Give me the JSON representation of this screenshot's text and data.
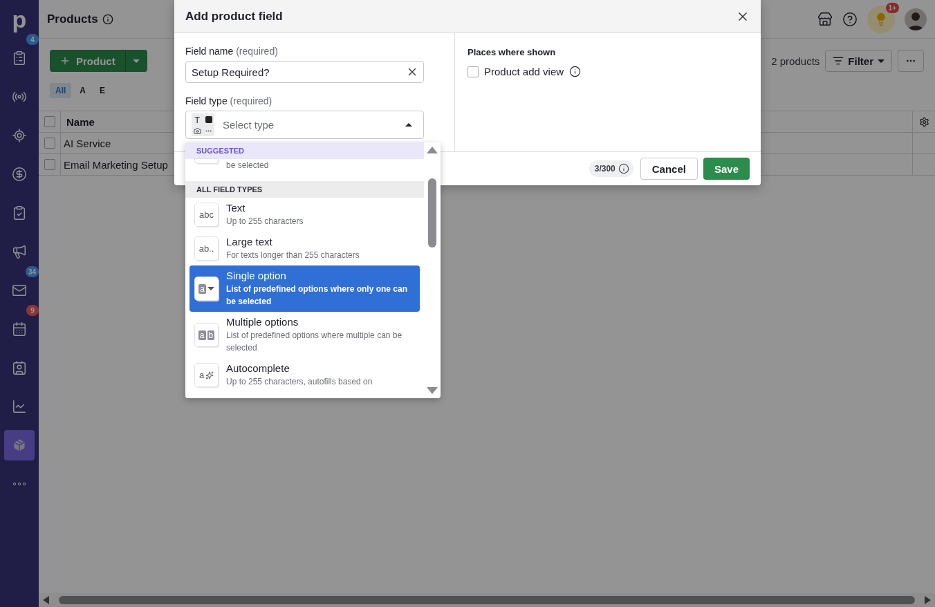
{
  "sidebar": {
    "logo": "p",
    "items": [
      {
        "selected": false,
        "badge": {
          "text": "4",
          "color": "#2b5a8f"
        }
      },
      {
        "selected": false
      },
      {
        "selected": false
      },
      {
        "selected": false
      },
      {
        "selected": false
      },
      {
        "selected": false
      },
      {
        "selected": false,
        "badge": {
          "text": "34",
          "color": "#2b5a8f"
        }
      },
      {
        "selected": false,
        "badge": {
          "text": "9",
          "color": "#8f3535"
        }
      },
      {
        "selected": false
      },
      {
        "selected": false
      },
      {
        "selected": true
      },
      {
        "selected": false
      }
    ]
  },
  "header": {
    "title": "Products",
    "notification_badge": "1+"
  },
  "toolbar": {
    "add_button": "Product",
    "count": "2 products",
    "filter_button": "Filter"
  },
  "letter_filters": [
    {
      "label": "All",
      "selected": true
    },
    {
      "label": "A",
      "selected": false
    },
    {
      "label": "E",
      "selected": false
    }
  ],
  "table": {
    "select_all_checked": false,
    "columns": [
      "Name"
    ],
    "rows": [
      {
        "name": "AI Service",
        "checked": false
      },
      {
        "name": "Email Marketing Setup",
        "checked": false
      }
    ]
  },
  "dialog": {
    "title": "Add product field",
    "field_name": {
      "label": "Field name",
      "hint": "(required)",
      "value": "Setup Required?"
    },
    "field_type": {
      "label": "Field type",
      "hint": "(required)",
      "icon_text": "T",
      "placeholder": "Select type",
      "expanded": true
    },
    "places": {
      "title": "Places where shown",
      "options": [
        {
          "label": "Product add view",
          "checked": false
        }
      ]
    },
    "counter": "3/300",
    "cancel": "Cancel",
    "save": "Save",
    "dropdown": {
      "sections": [
        {
          "title": "SUGGESTED",
          "kind": "suggested",
          "items": [
            {
              "kind": "partial",
              "description": "be selected",
              "selected": false
            }
          ]
        },
        {
          "title": "ALL FIELD TYPES",
          "kind": "all",
          "items": [
            {
              "kind": "plain",
              "icon_text": [
                "abc"
              ],
              "title": "Text",
              "description": "Up to 255 characters",
              "selected": false
            },
            {
              "kind": "plain",
              "icon_text": [
                "ab.."
              ],
              "title": "Large text",
              "description": "For texts longer than 255 characters",
              "selected": false
            },
            {
              "kind": "dropdown",
              "icon_text": [
                "a"
              ],
              "title": "Single option",
              "description": "List of predefined options where only one can be selected",
              "selected": true
            },
            {
              "kind": "chips",
              "icon_text": [
                "a",
                "b"
              ],
              "title": "Multiple options",
              "description": "List of predefined options where multiple can be selected",
              "selected": false
            },
            {
              "kind": "sparkle",
              "icon_text": [
                "a"
              ],
              "title": "Autocomplete",
              "description": "Up to 255 characters, autofills based on",
              "selected": false
            }
          ]
        }
      ]
    }
  }
}
